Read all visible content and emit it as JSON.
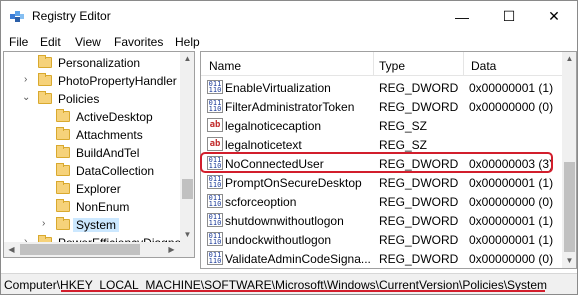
{
  "window": {
    "title": "Registry Editor",
    "buttons": {
      "minimize": "—",
      "maximize": "☐",
      "close": "✕"
    }
  },
  "menu": [
    "File",
    "Edit",
    "View",
    "Favorites",
    "Help"
  ],
  "tree": {
    "items": [
      {
        "label": "Personalization",
        "expander": ""
      },
      {
        "label": "PhotoPropertyHandler",
        "expander": "›"
      },
      {
        "label": "Policies",
        "expander": "⌄"
      },
      {
        "label": "ActiveDesktop",
        "expander": ""
      },
      {
        "label": "Attachments",
        "expander": ""
      },
      {
        "label": "BuildAndTel",
        "expander": ""
      },
      {
        "label": "DataCollection",
        "expander": ""
      },
      {
        "label": "Explorer",
        "expander": ""
      },
      {
        "label": "NonEnum",
        "expander": ""
      },
      {
        "label": "System",
        "expander": "›"
      },
      {
        "label": "PowerEfficiencyDiagno",
        "expander": "›"
      }
    ],
    "selected": "System"
  },
  "list": {
    "columns": {
      "name": "Name",
      "type": "Type",
      "data": "Data"
    },
    "rows": [
      {
        "icon": "dword",
        "name": "EnableVirtualization",
        "type": "REG_DWORD",
        "data": "0x00000001 (1)"
      },
      {
        "icon": "dword",
        "name": "FilterAdministratorToken",
        "type": "REG_DWORD",
        "data": "0x00000000 (0)"
      },
      {
        "icon": "string",
        "name": "legalnoticecaption",
        "type": "REG_SZ",
        "data": ""
      },
      {
        "icon": "string",
        "name": "legalnoticetext",
        "type": "REG_SZ",
        "data": ""
      },
      {
        "icon": "dword",
        "name": "NoConnectedUser",
        "type": "REG_DWORD",
        "data": "0x00000003 (3)"
      },
      {
        "icon": "dword",
        "name": "PromptOnSecureDesktop",
        "type": "REG_DWORD",
        "data": "0x00000001 (1)"
      },
      {
        "icon": "dword",
        "name": "scforceoption",
        "type": "REG_DWORD",
        "data": "0x00000000 (0)"
      },
      {
        "icon": "dword",
        "name": "shutdownwithoutlogon",
        "type": "REG_DWORD",
        "data": "0x00000001 (1)"
      },
      {
        "icon": "dword",
        "name": "undockwithoutlogon",
        "type": "REG_DWORD",
        "data": "0x00000001 (1)"
      },
      {
        "icon": "dword",
        "name": "ValidateAdminCodeSigna...",
        "type": "REG_DWORD",
        "data": "0x00000000 (0)"
      }
    ],
    "highlighted": "NoConnectedUser"
  },
  "icon_glyphs": {
    "dword": "011\n110",
    "string": "ab"
  },
  "status": {
    "path": "Computer\\HKEY_LOCAL_MACHINE\\SOFTWARE\\Microsoft\\Windows\\CurrentVersion\\Policies\\System"
  },
  "colors": {
    "annotation": "#d21e2c",
    "folder": "#f6d27a",
    "selection": "#cce8ff"
  }
}
